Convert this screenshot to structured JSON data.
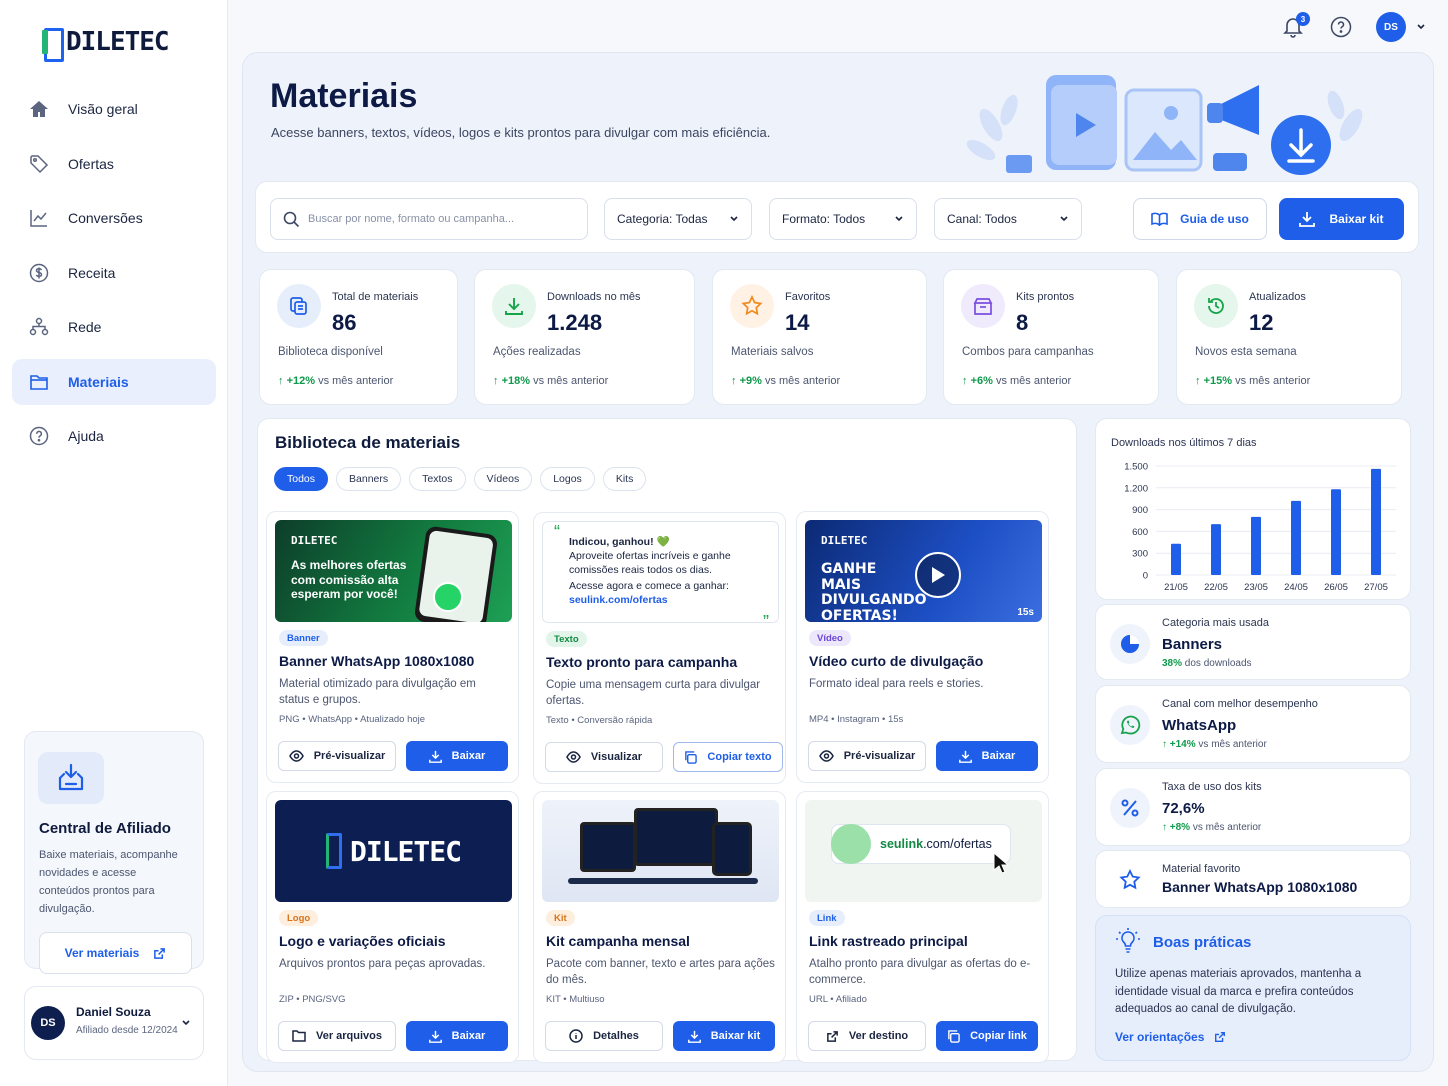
{
  "brand": {
    "name": "DILETEC"
  },
  "nav": [
    {
      "label": "Visão geral",
      "icon": "home-icon"
    },
    {
      "label": "Ofertas",
      "icon": "tag-icon"
    },
    {
      "label": "Conversões",
      "icon": "chart-line-icon"
    },
    {
      "label": "Receita",
      "icon": "dollar-circle-icon"
    },
    {
      "label": "Rede",
      "icon": "network-icon"
    },
    {
      "label": "Materiais",
      "icon": "folder-icon",
      "active": true
    },
    {
      "label": "Ajuda",
      "icon": "help-circle-icon"
    }
  ],
  "affiliate": {
    "title": "Central de Afiliado",
    "text": "Baixe materiais, acompanhe novidades e acesse conteúdos prontos para divulgação.",
    "button": "Ver materiais"
  },
  "user": {
    "initials": "DS",
    "name": "Daniel Souza",
    "since": "Afiliado desde 12/2024"
  },
  "topbar": {
    "notifications": "3",
    "initials": "DS"
  },
  "page": {
    "title": "Materiais",
    "subtitle": "Acesse banners, textos, vídeos, logos e kits prontos para divulgar com mais eficiência."
  },
  "toolbar": {
    "search_placeholder": "Buscar por nome, formato ou campanha...",
    "category": "Categoria: Todas",
    "format": "Formato: Todos",
    "channel": "Canal: Todos",
    "guide": "Guia de uso",
    "download_kit": "Baixar kit"
  },
  "stats": [
    {
      "label": "Total de materiais",
      "value": "86",
      "desc": "Biblioteca disponível",
      "trend": "+12%",
      "trend_text": "vs mês anterior",
      "color": "#e6eefc",
      "icon_color": "#1e5ee8"
    },
    {
      "label": "Downloads no mês",
      "value": "1.248",
      "desc": "Ações realizadas",
      "trend": "+18%",
      "trend_text": "vs mês anterior",
      "color": "#e5f6ec",
      "icon_color": "#17a34a"
    },
    {
      "label": "Favoritos",
      "value": "14",
      "desc": "Materiais salvos",
      "trend": "+9%",
      "trend_text": "vs mês anterior",
      "color": "#fff1e3",
      "icon_color": "#f08a1c"
    },
    {
      "label": "Kits prontos",
      "value": "8",
      "desc": "Combos para campanhas",
      "trend": "+6%",
      "trend_text": "vs mês anterior",
      "color": "#efeafc",
      "icon_color": "#7b4fe0"
    },
    {
      "label": "Atualizados",
      "value": "12",
      "desc": "Novos esta semana",
      "trend": "+15%",
      "trend_text": "vs mês anterior",
      "color": "#e5f6ec",
      "icon_color": "#17a34a"
    }
  ],
  "library": {
    "title": "Biblioteca de materiais",
    "filters": [
      "Todos",
      "Banners",
      "Textos",
      "Vídeos",
      "Logos",
      "Kits"
    ],
    "cards": [
      {
        "tag": "Banner",
        "title": "Banner WhatsApp 1080x1080",
        "desc": "Material otimizado para divulgação em status e grupos.",
        "meta": "PNG  •  WhatsApp  •  Atualizado hoje",
        "b1": "Pré-visualizar",
        "b2": "Baixar",
        "thumb": "As melhores ofertas com comissão alta esperam por você!"
      },
      {
        "tag": "Texto",
        "title": "Texto pronto para campanha",
        "desc": "Copie uma mensagem curta para divulgar ofertas.",
        "meta": "Texto  •  Conversão rápida",
        "b1": "Visualizar",
        "b2": "Copiar texto",
        "q1": "Indicou, ganhou! 💚",
        "q2": "Aproveite ofertas incríveis e ganhe comissões reais todos os dias.",
        "q3": "Acesse agora e comece a ganhar:",
        "q4": "seulink.com/ofertas"
      },
      {
        "tag": "Vídeo",
        "title": "Vídeo curto de divulgação",
        "desc": "Formato ideal para reels e stories.",
        "meta": "MP4  •  Instagram  •  15s",
        "b1": "Pré-visualizar",
        "b2": "Baixar",
        "thumb": "GANHE MAIS DIVULGANDO OFERTAS!",
        "duration": "15s"
      },
      {
        "tag": "Logo",
        "title": "Logo e variações oficiais",
        "desc": "Arquivos prontos para peças aprovadas.",
        "meta": "ZIP  •  PNG/SVG",
        "b1": "Ver arquivos",
        "b2": "Baixar"
      },
      {
        "tag": "Kit",
        "title": "Kit campanha mensal",
        "desc": "Pacote com banner, texto e artes para ações do mês.",
        "meta": "KIT  •  Multiuso",
        "b1": "Detalhes",
        "b2": "Baixar kit"
      },
      {
        "tag": "Link",
        "title": "Link rastreado principal",
        "desc": "Atalho pronto para divulgar as ofertas do e-commerce.",
        "meta": "URL  •  Afiliado",
        "b1": "Ver destino",
        "b2": "Copiar link",
        "link_a": "seulink",
        "link_b": ".com/ofertas"
      }
    ]
  },
  "chart_data": {
    "type": "bar",
    "title": "Downloads nos últimos 7 dias",
    "categories": [
      "21/05",
      "22/05",
      "23/05",
      "24/05",
      "26/05",
      "27/05"
    ],
    "values": [
      430,
      700,
      800,
      1020,
      1180,
      1460
    ],
    "y_ticks": [
      "1.500",
      "1.200",
      "900",
      "600",
      "300",
      "0"
    ],
    "ylim": [
      0,
      1500
    ],
    "grid": true,
    "color": "#1e5ee8"
  },
  "insights": [
    {
      "label": "Categoria mais usada",
      "value": "Banners",
      "sub_b": "38%",
      "sub": "dos downloads",
      "icon": "pie-chart-icon"
    },
    {
      "label": "Canal com melhor desempenho",
      "value": "WhatsApp",
      "sub_b": "↑ +14%",
      "sub": "vs mês anterior",
      "icon": "whatsapp-icon"
    },
    {
      "label": "Taxa de uso dos kits",
      "value": "72,6%",
      "sub_b": "↑ +8%",
      "sub": "vs mês anterior",
      "icon": "percent-icon"
    },
    {
      "label": "Material favorito",
      "value": "Banner WhatsApp 1080x1080",
      "icon": "star-icon"
    }
  ],
  "tips": {
    "title": "Boas práticas",
    "text": "Utilize apenas materiais aprovados, mantenha a identidade visual da marca e prefira conteúdos adequados ao canal de divulgação.",
    "link": "Ver orientações"
  }
}
